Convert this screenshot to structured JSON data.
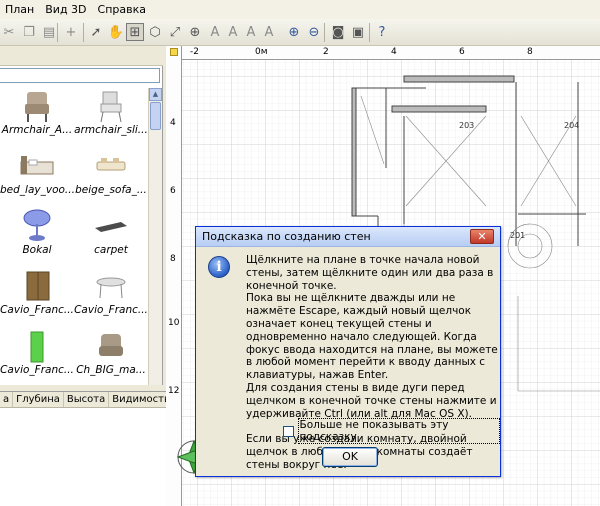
{
  "menu": {
    "items": [
      "План",
      "Вид 3D",
      "Справка"
    ]
  },
  "toolbar": {
    "buttons": [
      "cut-icon",
      "copy-icon",
      "paste-icon",
      "add-furniture-icon",
      "select-icon",
      "pan-icon",
      "create-walls-icon",
      "create-rooms-icon",
      "create-dimensions-icon",
      "add-text-icon",
      "text-style-icons",
      "zoom-in-icon",
      "zoom-out-icon",
      "create-photo-icon",
      "create-video-icon",
      "help-icon"
    ]
  },
  "catalog": {
    "search": {
      "value": ""
    },
    "items": [
      {
        "name": "Armchair_A..."
      },
      {
        "name": "armchair_sli..."
      },
      {
        "name": "bed_lay_voo..."
      },
      {
        "name": "beige_sofa_..."
      },
      {
        "name": "Bokal"
      },
      {
        "name": "carpet"
      },
      {
        "name": "Cavio_Franc..."
      },
      {
        "name": "Cavio_Franc..."
      },
      {
        "name": "Cavio_Franc..."
      },
      {
        "name": "Ch_BIG_ma..."
      }
    ]
  },
  "furniture_table": {
    "columns": [
      "а",
      "Глубина",
      "Высота",
      "Видимость"
    ]
  },
  "plan": {
    "ruler_top": [
      "-2",
      "0м",
      "2",
      "4",
      "6",
      "8"
    ],
    "ruler_left": [
      "4",
      "6",
      "8",
      "10",
      "12"
    ],
    "room_labels": [
      "203",
      "204",
      "201",
      "202"
    ]
  },
  "dialog": {
    "title": "Подсказка по созданию стен",
    "close_label": "✕",
    "paragraphs": [
      "Щёлкните на плане в точке начала новой стены, затем щёлкните один или два раза в конечной точке.",
      "Пока вы не щёлкните дважды или не нажмёте Escape, каждый новый щелчок означает конец текущей стены и одновременно начало следующей. Когда фокус ввода находится на плане, вы можете в любой момент перейти к вводу данных с клавиатуры, нажав Enter.",
      "Для создания стены в виде дуги перед щелчком в конечной точке стены нажмите и удерживайте Ctrl (или alt для Mac OS X).",
      "Если вы уже создали комнату, двойной щелчок в любом месте комнаты создаёт стены вокруг неё."
    ],
    "checkbox_label": "Больше не показывать эту подсказку",
    "checkbox_checked": false,
    "ok_label": "OK"
  },
  "colors": {
    "dialog_border": "#0831d9",
    "close_button": "#c2382a",
    "accent": "#2a60c8",
    "plan_line": "#777777"
  }
}
